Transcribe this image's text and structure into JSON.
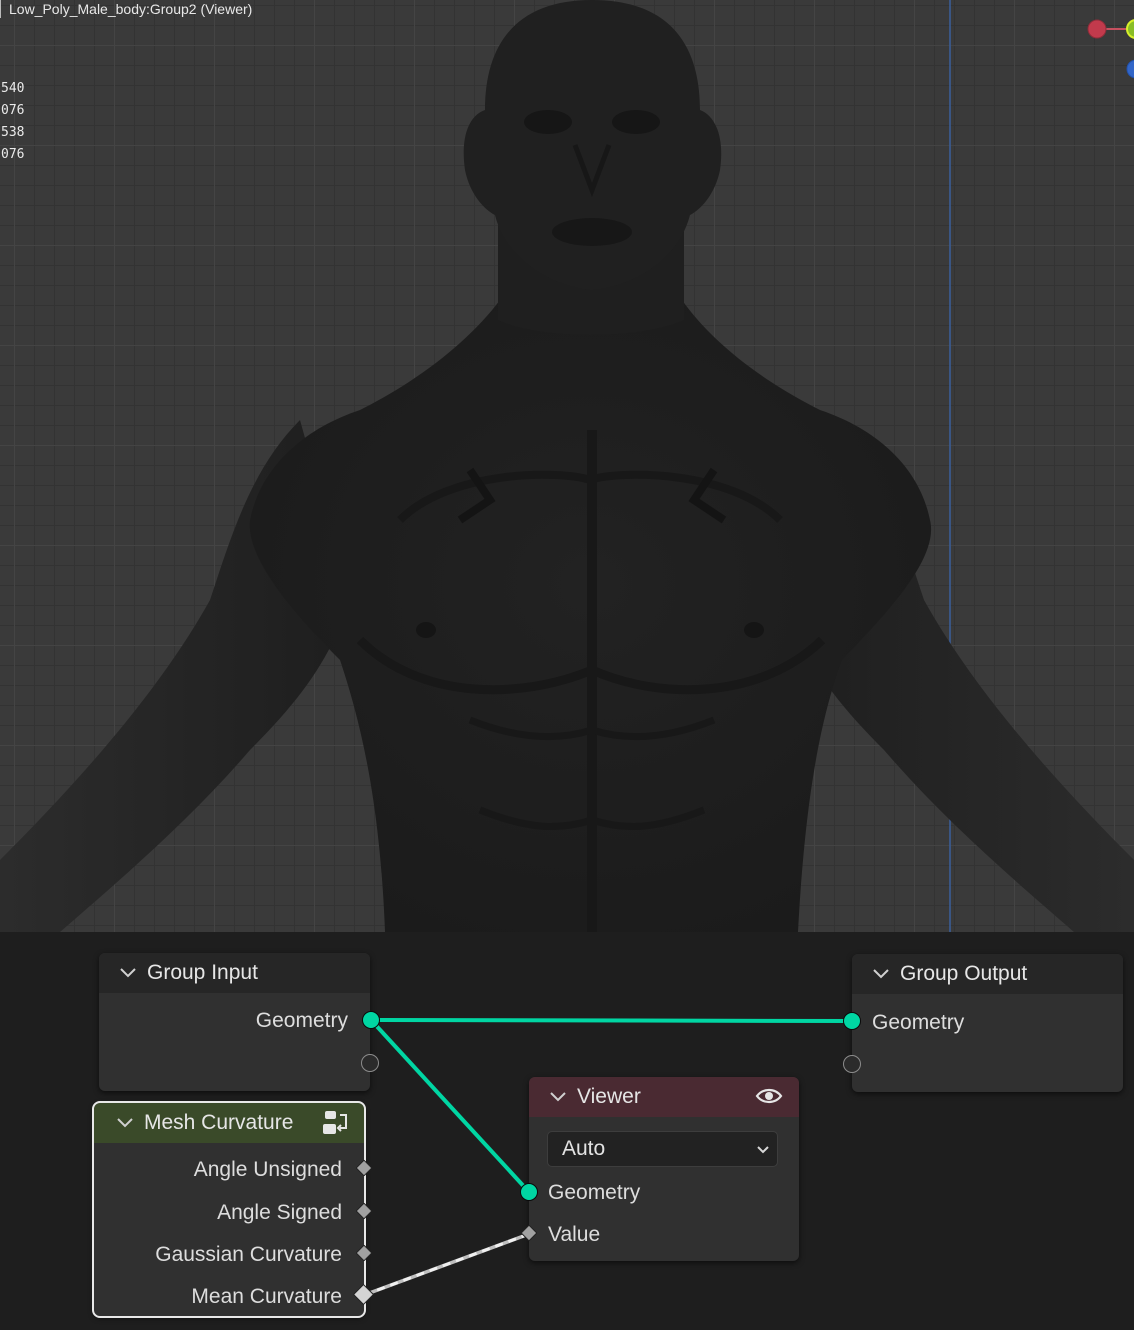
{
  "viewport": {
    "title": "Low_Poly_Male_body:Group2 (Viewer)",
    "stats": [
      "540",
      "076",
      "538",
      "076"
    ],
    "gizmo_icons": [
      "x-axis-icon",
      "y-axis-icon",
      "z-axis-icon"
    ],
    "accent": "#00d6a3"
  },
  "nodes": {
    "group_input": {
      "title": "Group Input",
      "outputs": [
        "Geometry"
      ]
    },
    "group_output": {
      "title": "Group Output",
      "inputs": [
        "Geometry"
      ]
    },
    "mesh_curvature": {
      "title": "Mesh Curvature",
      "outputs": [
        "Angle Unsigned",
        "Angle Signed",
        "Gaussian Curvature",
        "Mean Curvature"
      ],
      "header_color": "#3a4a29"
    },
    "viewer": {
      "title": "Viewer",
      "domain": "Auto",
      "inputs": [
        "Geometry",
        "Value"
      ],
      "header_color": "#4a2a32"
    }
  },
  "colors": {
    "geometry_socket": "#00d6a3",
    "float_socket": "#a1a1a1"
  }
}
